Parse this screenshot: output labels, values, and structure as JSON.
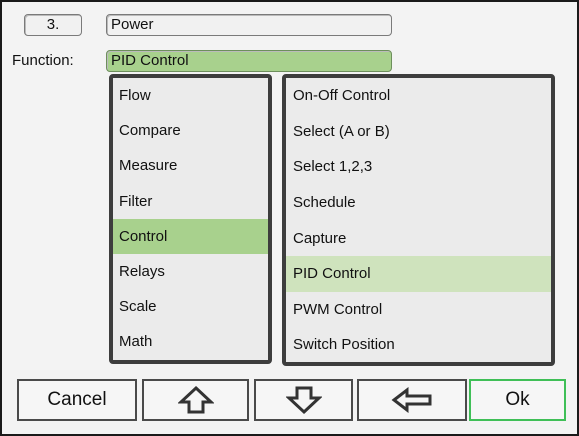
{
  "header": {
    "number": "3.",
    "name": "Power",
    "function_label": "Function:",
    "function_value": "PID Control"
  },
  "categories": {
    "selected_index": 4,
    "items": [
      "Flow",
      "Compare",
      "Measure",
      "Filter",
      "Control",
      "Relays",
      "Scale",
      "Math"
    ]
  },
  "functions": {
    "selected_index": 5,
    "items": [
      "On-Off Control",
      "Select (A or B)",
      "Select 1,2,3",
      "Schedule",
      "Capture",
      "PID Control",
      "PWM Control",
      "Switch Position"
    ]
  },
  "buttons": {
    "cancel": "Cancel",
    "up_icon": "arrow-up-icon",
    "down_icon": "arrow-down-icon",
    "back_icon": "arrow-left-icon",
    "ok": "Ok"
  },
  "colors": {
    "selected": "#a8d18d",
    "selected_light": "#cfe3bd",
    "ok_border": "#3fbf57"
  }
}
